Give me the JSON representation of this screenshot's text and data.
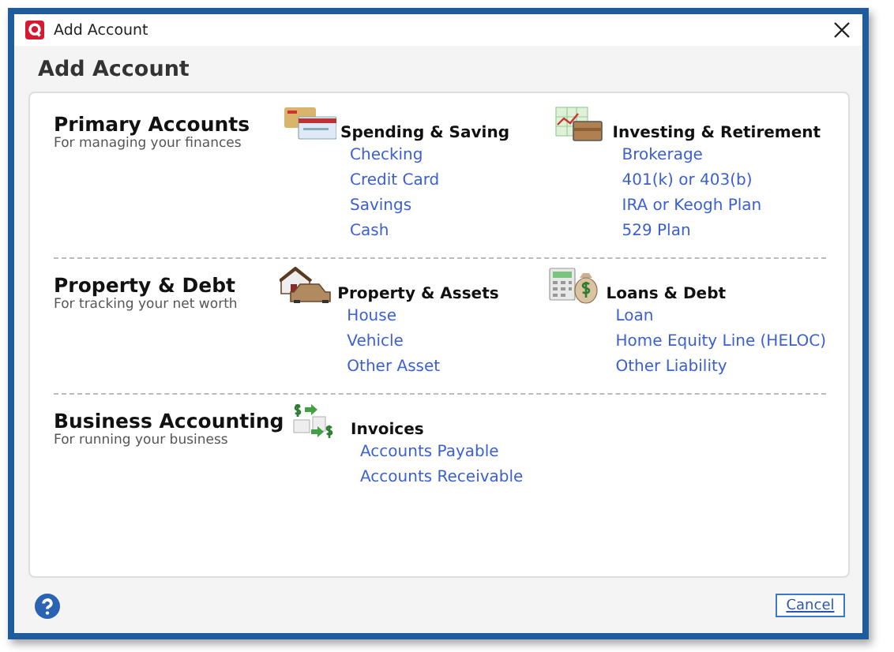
{
  "window": {
    "title": "Add Account"
  },
  "header": {
    "title": "Add Account"
  },
  "sections": [
    {
      "title": "Primary Accounts",
      "subtitle": "For managing your finances",
      "groups": [
        {
          "kind": "cards",
          "title": "Spending & Saving",
          "links": [
            "Checking",
            "Credit Card",
            "Savings",
            "Cash"
          ]
        },
        {
          "kind": "chart",
          "title": "Investing & Retirement",
          "links": [
            "Brokerage",
            "401(k) or 403(b)",
            "IRA or Keogh Plan",
            "529 Plan"
          ]
        }
      ]
    },
    {
      "title": "Property & Debt",
      "subtitle": "For tracking your net worth",
      "groups": [
        {
          "kind": "house",
          "title": "Property & Assets",
          "links": [
            "House",
            "Vehicle",
            "Other Asset"
          ]
        },
        {
          "kind": "loan",
          "title": "Loans & Debt",
          "links": [
            "Loan",
            "Home Equity Line (HELOC)",
            "Other Liability"
          ]
        }
      ]
    },
    {
      "title": "Business Accounting",
      "subtitle": "For running your business",
      "groups": [
        {
          "kind": "invoice",
          "title": "Invoices",
          "links": [
            "Accounts Payable",
            "Accounts Receivable"
          ]
        }
      ]
    }
  ],
  "footer": {
    "cancel": "Cancel"
  }
}
